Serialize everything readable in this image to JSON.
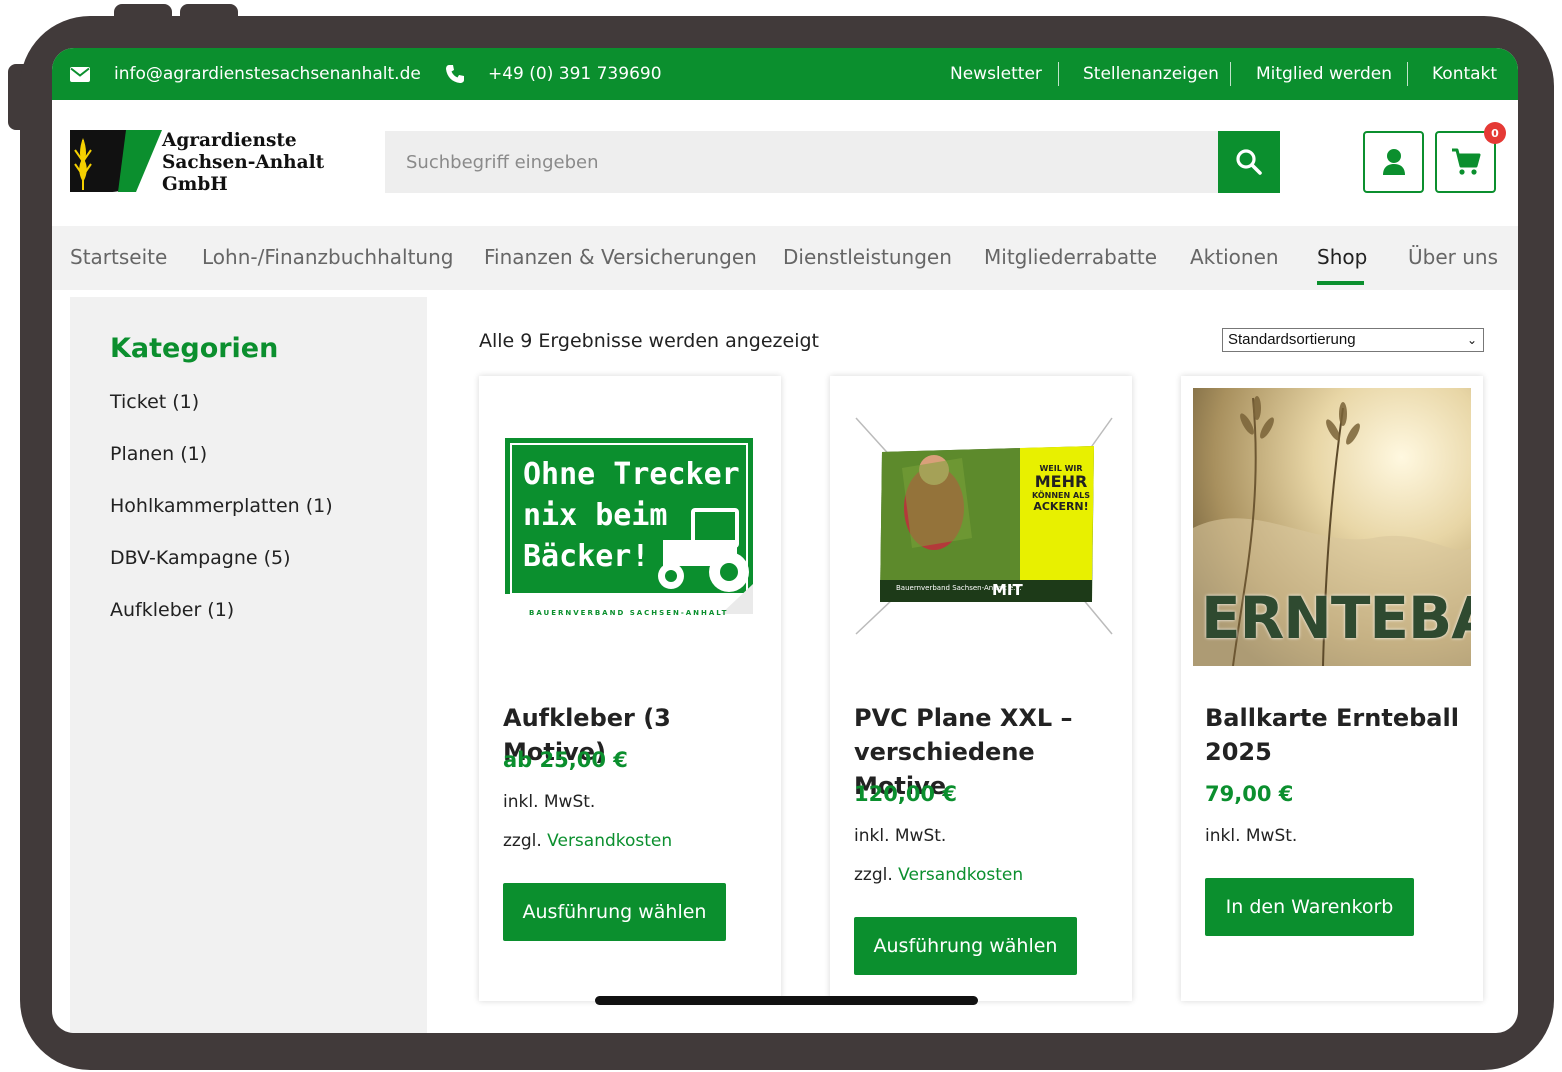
{
  "topbar": {
    "email": "info@agrardienstesachsenanhalt.de",
    "phone": "+49 (0) 391 739690",
    "links": [
      "Newsletter",
      "Stellenanzeigen",
      "Mitglied werden",
      "Kontakt"
    ]
  },
  "header": {
    "logo_lines": [
      "Agrardienste",
      "Sachsen-Anhalt",
      "GmbH"
    ],
    "search_placeholder": "Suchbegriff eingeben",
    "cart_count": "0"
  },
  "nav": {
    "items": [
      "Startseite",
      "Lohn-/Finanzbuchhaltung",
      "Finanzen & Versicherungen",
      "Dienstleistungen",
      "Mitgliederrabatte",
      "Aktionen",
      "Shop",
      "Über uns"
    ],
    "active": "Shop"
  },
  "sidebar": {
    "title": "Kategorien",
    "categories": [
      {
        "label": "Ticket  (1)"
      },
      {
        "label": "Planen  (1)"
      },
      {
        "label": "Hohlkammerplatten  (1)"
      },
      {
        "label": "DBV-Kampagne  (5)"
      },
      {
        "label": "Aufkleber  (1)"
      }
    ]
  },
  "main": {
    "results_text": "Alle 9 Ergebnisse werden angezeigt",
    "sort_selected": "Standardsortierung",
    "products": [
      {
        "title": "Aufkleber (3 Motive)",
        "price": "ab 25,00 €",
        "vat": "inkl. MwSt.",
        "shipping_prefix": "zzgl.",
        "shipping_link": "Versandkosten",
        "button": "Ausführung wählen",
        "image_text": [
          "Ohne Trecker",
          "nix beim",
          "Bäcker!"
        ],
        "image_footer": "BAUERNVERBAND SACHSEN-ANHALT"
      },
      {
        "title": "PVC Plane XXL – verschiedene Motive",
        "price": "120,00 €",
        "vat": "inkl. MwSt.",
        "shipping_prefix": "zzgl.",
        "shipping_link": "Versandkosten",
        "button": "Ausführung wählen",
        "image_text": [
          "WEIL WIR",
          "MEHR",
          "KÖNNEN ALS",
          "ACKERN!",
          "MIT"
        ],
        "image_footer": "Bauernverband Sachsen-Anhalt e.V."
      },
      {
        "title": "Ballkarte Ernteball 2025",
        "price": "79,00 €",
        "vat": "inkl. MwSt.",
        "button": "In den Warenkorb",
        "image_text": [
          "ERNTEBA"
        ]
      }
    ]
  },
  "colors": {
    "brand_green": "#0b8f2e",
    "badge_red": "#e53935",
    "frame": "#413a3a"
  },
  "icons": [
    "envelope-icon",
    "phone-icon",
    "search-icon",
    "user-icon",
    "cart-icon"
  ]
}
